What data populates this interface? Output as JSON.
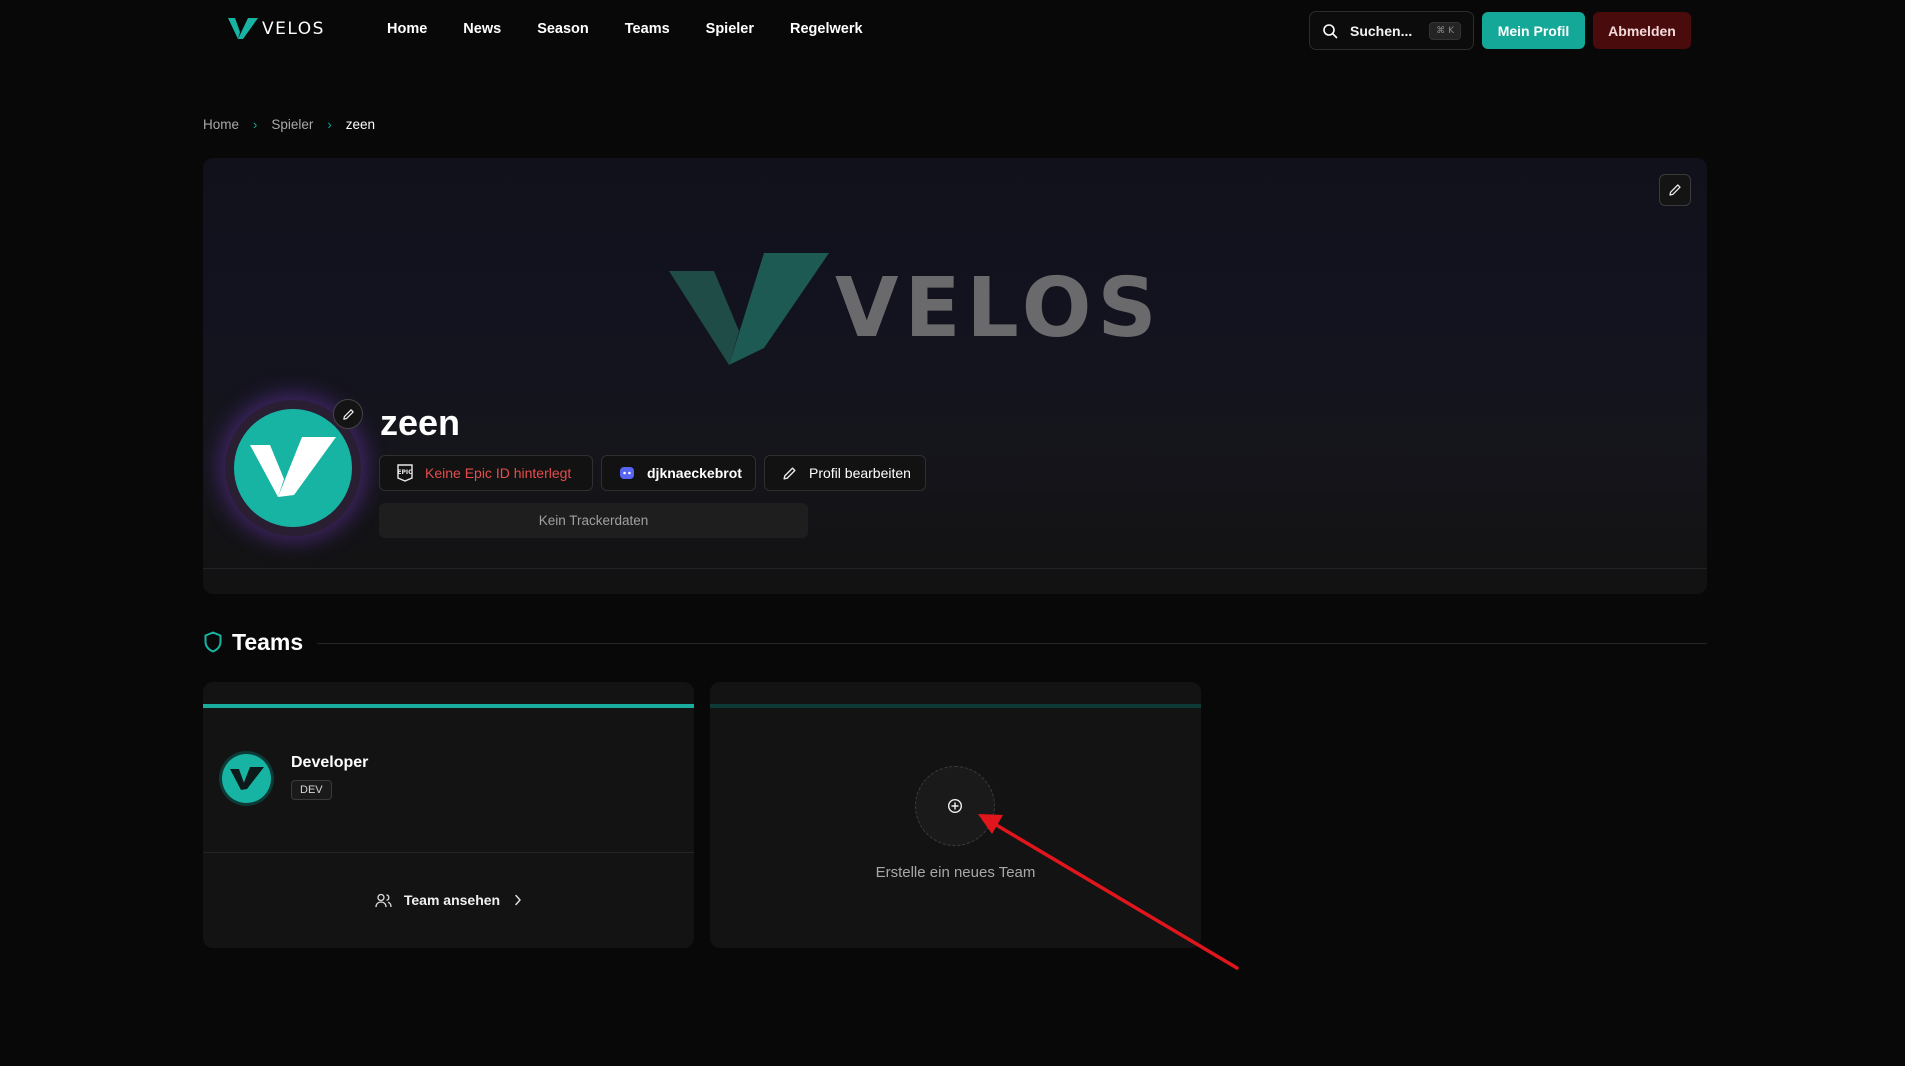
{
  "nav": {
    "brand": "VELOS",
    "links": [
      "Home",
      "News",
      "Season",
      "Teams",
      "Spieler",
      "Regelwerk"
    ],
    "search_label": "Suchen...",
    "search_shortcut": "⌘ K",
    "profile_button": "Mein Profil",
    "logout_button": "Abmelden"
  },
  "breadcrumb": [
    "Home",
    "Spieler",
    "zeen"
  ],
  "profile": {
    "banner_wordmark": "VELOS",
    "name": "zeen",
    "epic_status": "Keine Epic ID hinterlegt",
    "discord_name": "djknaeckebrot",
    "edit_label": "Profil bearbeiten",
    "tracker_text": "Kein Trackerdaten"
  },
  "teams": {
    "heading": "Teams",
    "items": [
      {
        "name": "Developer",
        "tag": "DEV",
        "view_label": "Team ansehen"
      }
    ],
    "create_label": "Erstelle ein neues Team"
  },
  "colors": {
    "accent": "#18b4a3",
    "danger": "#e54c4c",
    "logout_bg": "#4a0b0d",
    "annotation_arrow": "#e0161c"
  }
}
